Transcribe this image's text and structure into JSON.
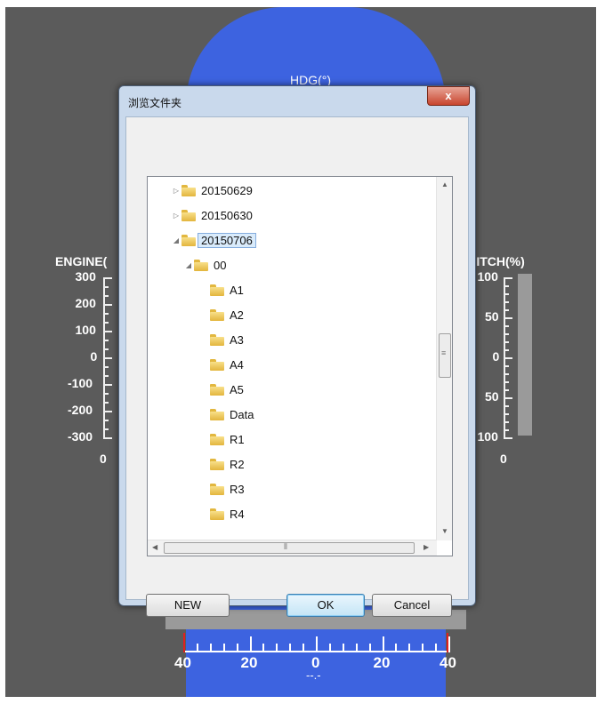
{
  "background_colors": {
    "panel": "#5b5b5b",
    "hdg_band": "#3d63e0"
  },
  "hdg": {
    "title": "HDG(°)"
  },
  "engine": {
    "title": "ENGINE(",
    "ticks": [
      "300",
      "200",
      "100",
      "0",
      "-100",
      "-200",
      "-300"
    ],
    "readout": "0"
  },
  "pitch": {
    "title": "PITCH(%)",
    "ticks": [
      "100",
      "50",
      "0",
      "50",
      "100"
    ],
    "readout": "0"
  },
  "bottom_scale": {
    "ticks": [
      "40",
      "20",
      "0",
      "20",
      "40"
    ],
    "readout": "--.-"
  },
  "dialog": {
    "title": "浏览文件夹",
    "close_label": "x",
    "tree": [
      {
        "label": "20150629",
        "icon": "folder-icon",
        "expander": "collapsed"
      },
      {
        "label": "20150630",
        "icon": "folder-icon",
        "expander": "collapsed"
      },
      {
        "label": "20150706",
        "icon": "folder-icon",
        "expander": "expanded",
        "selected": true
      },
      {
        "label": "00",
        "icon": "folder-icon",
        "expander": "expanded"
      },
      {
        "label": "A1",
        "icon": "folder-icon"
      },
      {
        "label": "A2",
        "icon": "folder-icon"
      },
      {
        "label": "A3",
        "icon": "folder-icon"
      },
      {
        "label": "A4",
        "icon": "folder-icon"
      },
      {
        "label": "A5",
        "icon": "folder-icon"
      },
      {
        "label": "Data",
        "icon": "folder-icon"
      },
      {
        "label": "R1",
        "icon": "folder-icon"
      },
      {
        "label": "R2",
        "icon": "folder-icon"
      },
      {
        "label": "R3",
        "icon": "folder-icon"
      },
      {
        "label": "R4",
        "icon": "folder-icon"
      }
    ],
    "buttons": {
      "new": "NEW",
      "ok": "OK",
      "cancel": "Cancel"
    }
  }
}
